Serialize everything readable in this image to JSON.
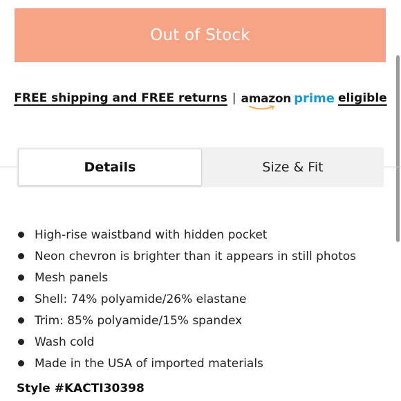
{
  "stock_button": {
    "label": "Out of Stock"
  },
  "shipping": {
    "link_text": "FREE shipping and FREE returns",
    "separator": "|",
    "amazon_label": "amazon",
    "prime_label": "prime",
    "eligible_text": "eligible"
  },
  "tabs": [
    {
      "label": "Details",
      "selected": true
    },
    {
      "label": "Size & Fit",
      "selected": false
    }
  ],
  "details": {
    "bullets": [
      "High-rise waistband with hidden pocket",
      "Neon chevron is brighter than it appears in still photos",
      "Mesh panels",
      "Shell: 74% polyamide/26% elastane",
      "Trim: 85% polyamide/15% spandex",
      "Wash cold",
      "Made in the USA of imported materials"
    ],
    "style_number": "Style #KACTI30398"
  },
  "colors": {
    "button_bg": "#f7a386",
    "prime_blue": "#1a98d5",
    "amazon_smile": "#f3a847",
    "tab_bar_bg": "#f1f1f1"
  }
}
